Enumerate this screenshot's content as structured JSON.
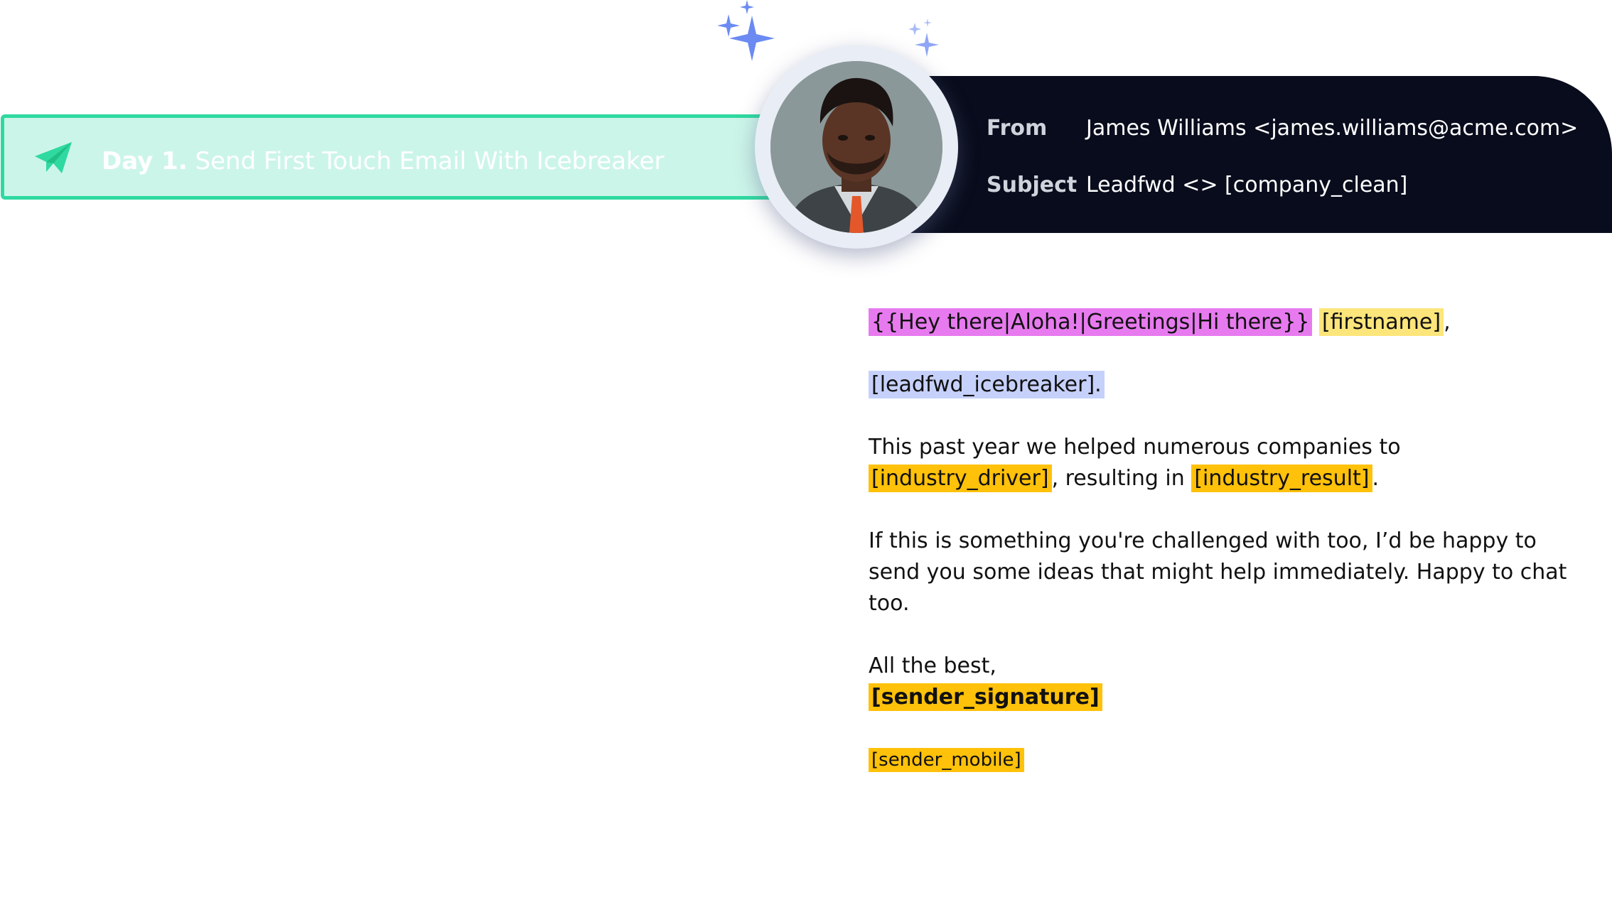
{
  "step": {
    "day_label": "Day 1.",
    "title": "Send First Touch Email With Icebreaker",
    "icon": "paper-plane-icon",
    "colors": {
      "fill": "#ccf5e9",
      "border": "#2fd9a0"
    }
  },
  "email_header": {
    "from_label": "From",
    "from_value": "James Williams <james.williams@acme.com>",
    "subject_label": "Subject",
    "subject_value": "Leadfwd <> [company_clean]",
    "background": "#080c1c"
  },
  "avatar": {
    "icon": "sender-avatar",
    "sparkle_icon": "sparkle-icon",
    "sparkle_color": "#6b8af2"
  },
  "body": {
    "greeting_spintax": "{{Hey there|Aloha!|Greetings|Hi there}}",
    "greeting_space": " ",
    "firstname_token": "[firstname]",
    "greeting_comma": ",",
    "icebreaker_token": "[leadfwd_icebreaker].",
    "p2_before": "This past year we helped numerous companies to ",
    "industry_driver_token": "[industry_driver]",
    "p2_middle": ", resulting in ",
    "industry_result_token": "[industry_result]",
    "p2_end": ".",
    "p3": "If this is something you're challenged with too, I’d be happy to send you some ideas that might help immediately. Happy to chat too.",
    "signoff": "All the best,",
    "signature_token": "[sender_signature]",
    "mobile_token": "[sender_mobile]"
  },
  "highlight_colors": {
    "spintax": "#e77aef",
    "firstname": "#fce57a",
    "icebreaker": "#c6d1fb",
    "variable": "#ffc10a"
  }
}
